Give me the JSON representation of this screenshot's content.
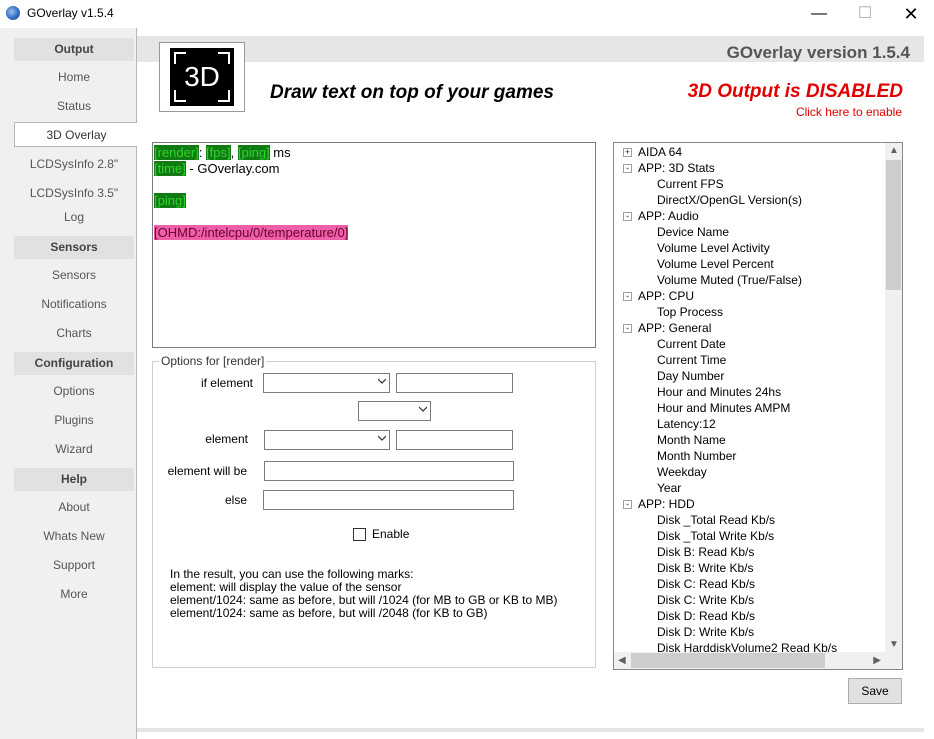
{
  "window": {
    "title": "GOverlay v1.5.4",
    "controls": {
      "minimize": "—",
      "maximize": "☐",
      "close": "✕"
    }
  },
  "sidebar": {
    "sections": [
      {
        "header": "Output",
        "items": [
          "Home",
          "Status",
          "3D Overlay",
          "LCDSysInfo 2.8\"",
          "LCDSysInfo 3.5\"",
          "Log"
        ]
      },
      {
        "header": "Sensors",
        "items": [
          "Sensors",
          "Notifications",
          "Charts"
        ]
      },
      {
        "header": "Configuration",
        "items": [
          "Options",
          "Plugins",
          "Wizard"
        ]
      },
      {
        "header": "Help",
        "items": [
          "About",
          "Whats New",
          "Support",
          "More"
        ]
      }
    ],
    "selected": "3D Overlay"
  },
  "header": {
    "version": "GOverlay version 1.5.4",
    "logo_text": "3D",
    "slogan": "Draw text on top of your games",
    "status": "3D Output is DISABLED",
    "status_link": "Click here to enable",
    "status_color": "#e00000"
  },
  "editor": {
    "line1": {
      "t1": "[render]",
      "t2": ": ",
      "t3": "[fps]",
      "t4": ", ",
      "t5": "[ping]",
      "t6": " ms"
    },
    "line2": {
      "t1": "[time]",
      "t2": " - GOverlay.com"
    },
    "line4": {
      "t1": "[ping]"
    },
    "line6": {
      "t1": "[OHMD:/intelcpu/0/temperature/0]"
    },
    "highlight_green": "#127a12",
    "highlight_pink": "#ef5fa7"
  },
  "options": {
    "legend": "Options for [render]",
    "if_element_label": "if element",
    "element_label": "element",
    "element_will_be_label": "element will be",
    "else_label": "else",
    "enable_label": "Enable",
    "enable_checked": false,
    "help": [
      "In the result, you can use the following marks:",
      "element: will display the value of the sensor",
      "element/1024: same as before, but will /1024 (for MB to GB or KB to MB)",
      "element/1024: same as before, but will /2048 (for KB to GB)"
    ]
  },
  "tree": {
    "nodes": [
      {
        "label": "AIDA 64",
        "level": 0,
        "expander": "+"
      },
      {
        "label": "APP: 3D Stats",
        "level": 0,
        "expander": "−"
      },
      {
        "label": "Current FPS",
        "level": 1
      },
      {
        "label": "DirectX/OpenGL Version(s)",
        "level": 1
      },
      {
        "label": "APP: Audio",
        "level": 0,
        "expander": "−"
      },
      {
        "label": "Device Name",
        "level": 1
      },
      {
        "label": "Volume Level Activity",
        "level": 1
      },
      {
        "label": "Volume Level Percent",
        "level": 1
      },
      {
        "label": "Volume Muted (True/False)",
        "level": 1
      },
      {
        "label": "APP: CPU",
        "level": 0,
        "expander": "−"
      },
      {
        "label": "Top Process",
        "level": 1
      },
      {
        "label": "APP: General",
        "level": 0,
        "expander": "−"
      },
      {
        "label": "Current Date",
        "level": 1
      },
      {
        "label": "Current Time",
        "level": 1
      },
      {
        "label": "Day Number",
        "level": 1
      },
      {
        "label": "Hour and Minutes 24hs",
        "level": 1
      },
      {
        "label": "Hour and Minutes AMPM",
        "level": 1
      },
      {
        "label": "Latency:12",
        "level": 1
      },
      {
        "label": "Month Name",
        "level": 1
      },
      {
        "label": "Month Number",
        "level": 1
      },
      {
        "label": "Weekday",
        "level": 1
      },
      {
        "label": "Year",
        "level": 1
      },
      {
        "label": "APP: HDD",
        "level": 0,
        "expander": "−"
      },
      {
        "label": "Disk _Total Read Kb/s",
        "level": 1
      },
      {
        "label": "Disk _Total Write Kb/s",
        "level": 1
      },
      {
        "label": "Disk B: Read Kb/s",
        "level": 1
      },
      {
        "label": "Disk B: Write Kb/s",
        "level": 1
      },
      {
        "label": "Disk C: Read Kb/s",
        "level": 1
      },
      {
        "label": "Disk C: Write Kb/s",
        "level": 1
      },
      {
        "label": "Disk D: Read Kb/s",
        "level": 1
      },
      {
        "label": "Disk D: Write Kb/s",
        "level": 1
      },
      {
        "label": "Disk HarddiskVolume2 Read Kb/s",
        "level": 1
      }
    ]
  },
  "footer": {
    "save_label": "Save"
  }
}
